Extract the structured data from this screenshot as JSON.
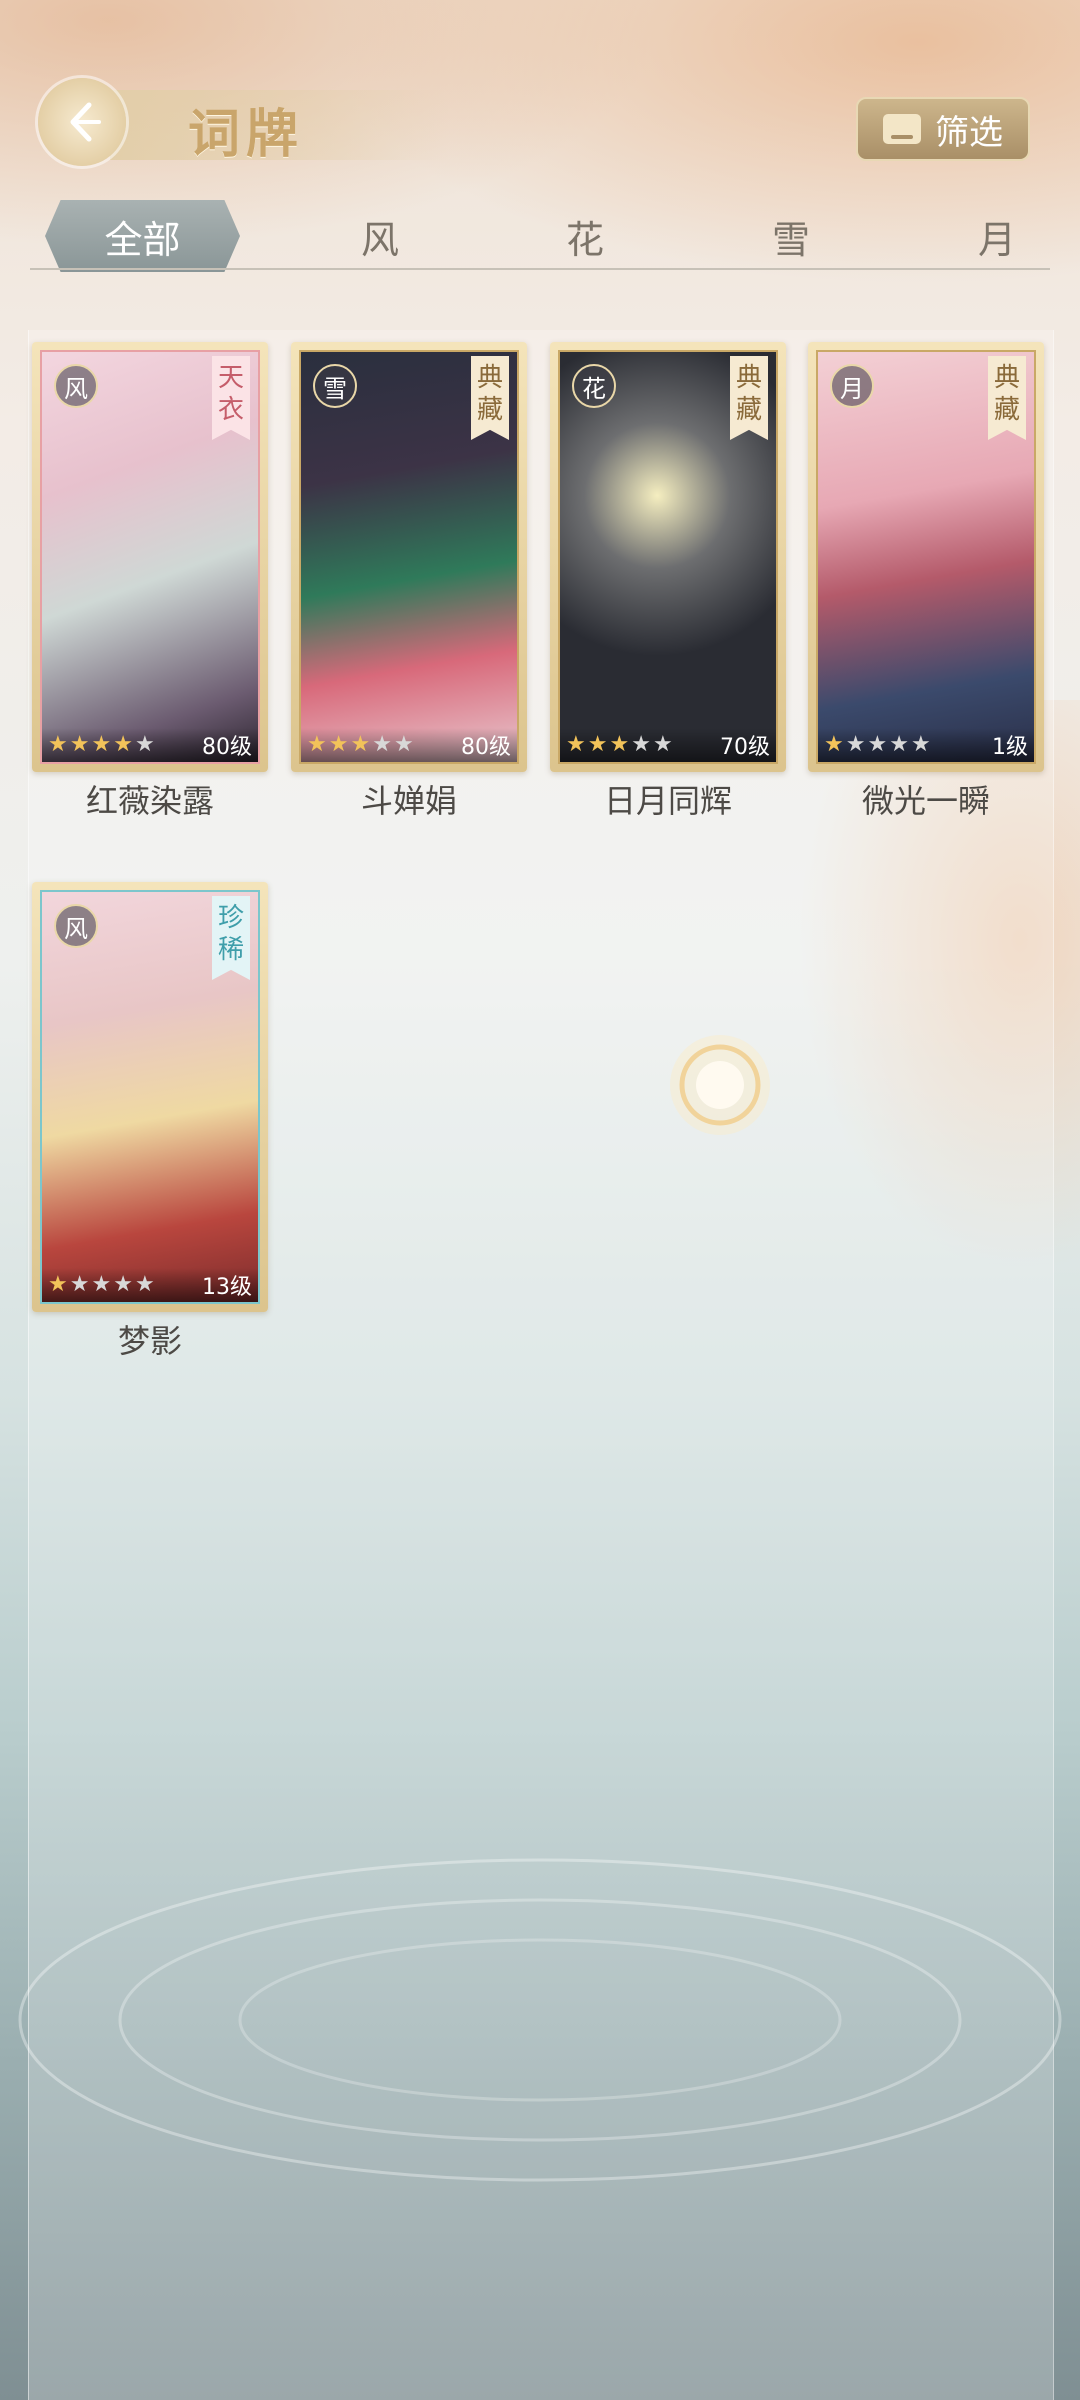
{
  "header": {
    "title": "词牌",
    "filter_label": "筛选"
  },
  "tabs": [
    {
      "label": "全部",
      "active": true
    },
    {
      "label": "风"
    },
    {
      "label": "花"
    },
    {
      "label": "雪"
    },
    {
      "label": "月"
    }
  ],
  "cards": [
    {
      "name": "红薇染露",
      "element": "风",
      "rarity": "天衣",
      "stars": 4,
      "max_stars": 5,
      "level": "80级",
      "theme": "pink"
    },
    {
      "name": "斗婵娟",
      "element": "雪",
      "rarity": "典藏",
      "stars": 3,
      "max_stars": 5,
      "level": "80级",
      "theme": "gold"
    },
    {
      "name": "日月同辉",
      "element": "花",
      "rarity": "典藏",
      "stars": 3,
      "max_stars": 5,
      "level": "70级",
      "theme": "gold"
    },
    {
      "name": "微光一瞬",
      "element": "月",
      "rarity": "典藏",
      "stars": 1,
      "max_stars": 5,
      "level": "1级",
      "theme": "gold"
    },
    {
      "name": "梦影",
      "element": "风",
      "rarity": "珍稀",
      "stars": 1,
      "max_stars": 5,
      "level": "13级",
      "theme": "teal"
    }
  ],
  "colors": {
    "accent_gold": "#c9a56b",
    "tab_active": "#8a9697",
    "text": "#4d4a46"
  }
}
